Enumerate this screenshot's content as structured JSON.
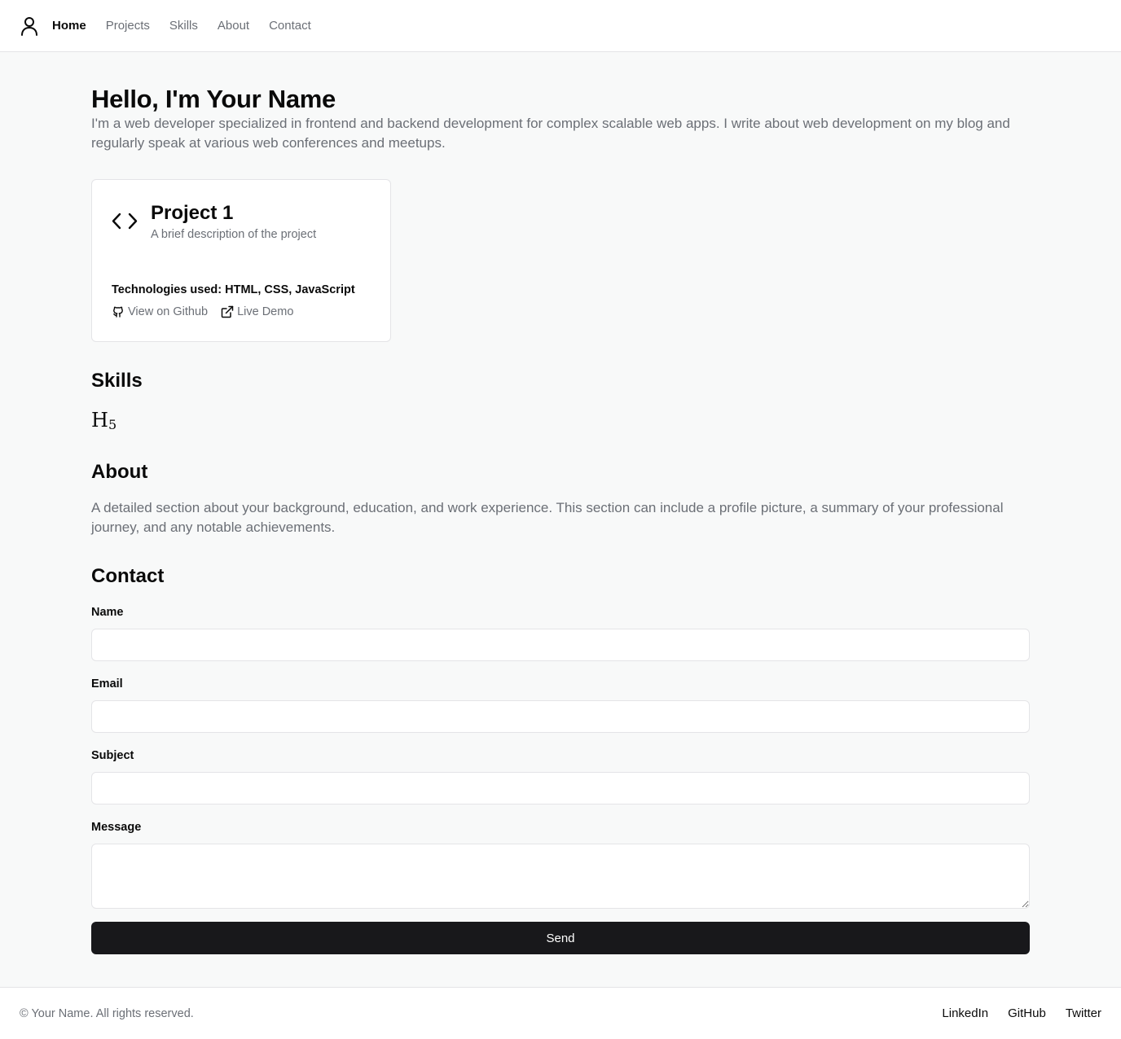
{
  "header": {
    "nav": {
      "home": "Home",
      "projects": "Projects",
      "skills": "Skills",
      "about": "About",
      "contact": "Contact"
    }
  },
  "hero": {
    "title": "Hello, I'm Your Name",
    "text": "I'm a web developer specialized in frontend and backend development for complex scalable web apps. I write about web development on my blog and regularly speak at various web conferences and meetups."
  },
  "project": {
    "title": "Project 1",
    "description": "A brief description of the project",
    "technologies": "Technologies used: HTML, CSS, JavaScript",
    "github_label": "View on Github",
    "demo_label": "Live Demo"
  },
  "skills": {
    "title": "Skills",
    "icon_label": "H5"
  },
  "about": {
    "title": "About",
    "text": "A detailed section about your background, education, and work experience. This section can include a profile picture, a summary of your professional journey, and any notable achievements."
  },
  "contact": {
    "title": "Contact",
    "name_label": "Name",
    "email_label": "Email",
    "subject_label": "Subject",
    "message_label": "Message",
    "send_label": "Send"
  },
  "footer": {
    "copyright": "© Your Name. All rights reserved.",
    "links": [
      "LinkedIn",
      "GitHub",
      "Twitter"
    ]
  },
  "icons": {
    "user": "user-icon",
    "code": "code-icon",
    "github": "github-icon",
    "external": "external-link-icon",
    "html5": "html5-icon"
  },
  "colors": {
    "background": "#f8f9f9",
    "surface": "#ffffff",
    "border": "#e4e4e7",
    "text_primary": "#0a0a0a",
    "text_muted": "#6b6f76",
    "button": "#18181b"
  }
}
